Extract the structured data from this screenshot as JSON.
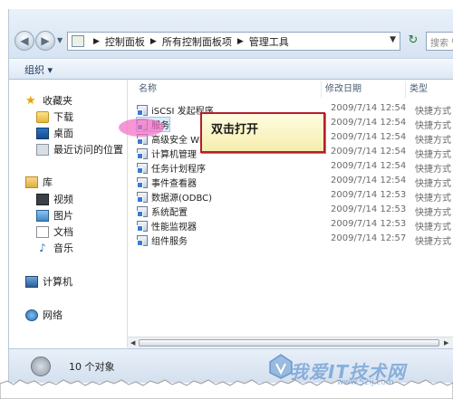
{
  "address": {
    "crumbs": [
      "控制面板",
      "所有控制面板项",
      "管理工具"
    ],
    "search_placeholder": "搜索 管"
  },
  "toolbar": {
    "organize_label": "组织 ▾"
  },
  "sidebar": {
    "favorites": "收藏夹",
    "fav_items": [
      "下载",
      "桌面",
      "最近访问的位置"
    ],
    "libraries": "库",
    "lib_items": [
      "视频",
      "图片",
      "文档",
      "音乐"
    ],
    "computer": "计算机",
    "network": "网络"
  },
  "columns": {
    "name": "名称",
    "date": "修改日期",
    "type": "类型"
  },
  "files": [
    {
      "name": "iSCSI 发起程序",
      "date": "2009/7/14 12:54",
      "type": "快捷方式"
    },
    {
      "name": "服务",
      "date": "2009/7/14 12:54",
      "type": "快捷方式"
    },
    {
      "name": "高级安全 Wi",
      "date": "2009/7/14 12:54",
      "type": "快捷方式"
    },
    {
      "name": "计算机管理",
      "date": "2009/7/14 12:54",
      "type": "快捷方式"
    },
    {
      "name": "任务计划程序",
      "date": "2009/7/14 12:54",
      "type": "快捷方式"
    },
    {
      "name": "事件查看器",
      "date": "2009/7/14 12:54",
      "type": "快捷方式"
    },
    {
      "name": "数据源(ODBC)",
      "date": "2009/7/14 12:53",
      "type": "快捷方式"
    },
    {
      "name": "系统配置",
      "date": "2009/7/14 12:53",
      "type": "快捷方式"
    },
    {
      "name": "性能监视器",
      "date": "2009/7/14 12:53",
      "type": "快捷方式"
    },
    {
      "name": "组件服务",
      "date": "2009/7/14 12:57",
      "type": "快捷方式"
    }
  ],
  "callout": {
    "text": "双击打开"
  },
  "status": {
    "text": "10 个对象"
  },
  "watermark": {
    "text": "我爱IT技术网",
    "url": "www.52ij.com"
  }
}
